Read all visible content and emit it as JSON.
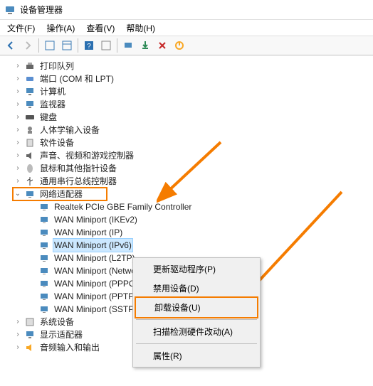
{
  "title": "设备管理器",
  "menu": {
    "file": "文件(F)",
    "action": "操作(A)",
    "view": "查看(V)",
    "help": "帮助(H)"
  },
  "tree": {
    "print_queues": "打印队列",
    "ports": "端口 (COM 和 LPT)",
    "computer": "计算机",
    "monitors": "监视器",
    "keyboards": "键盘",
    "hid": "人体学输入设备",
    "software_devices": "软件设备",
    "sound": "声音、视频和游戏控制器",
    "mouse": "鼠标和其他指针设备",
    "usb": "通用串行总线控制器",
    "network_adapters": "网络适配器",
    "na_items": [
      "Realtek PCIe GBE Family Controller",
      "WAN Miniport (IKEv2)",
      "WAN Miniport (IP)",
      "WAN Miniport (IPv6)",
      "WAN Miniport (L2TP)",
      "WAN Miniport (Network Monitor)",
      "WAN Miniport (PPPOE)",
      "WAN Miniport (PPTP)",
      "WAN Miniport (SSTP)"
    ],
    "system_devices": "系统设备",
    "display_adapters": "显示适配器",
    "audio_io": "音频输入和输出"
  },
  "context_menu": {
    "update_driver": "更新驱动程序(P)",
    "disable": "禁用设备(D)",
    "uninstall": "卸载设备(U)",
    "scan": "扫描检测硬件改动(A)",
    "properties": "属性(R)"
  }
}
